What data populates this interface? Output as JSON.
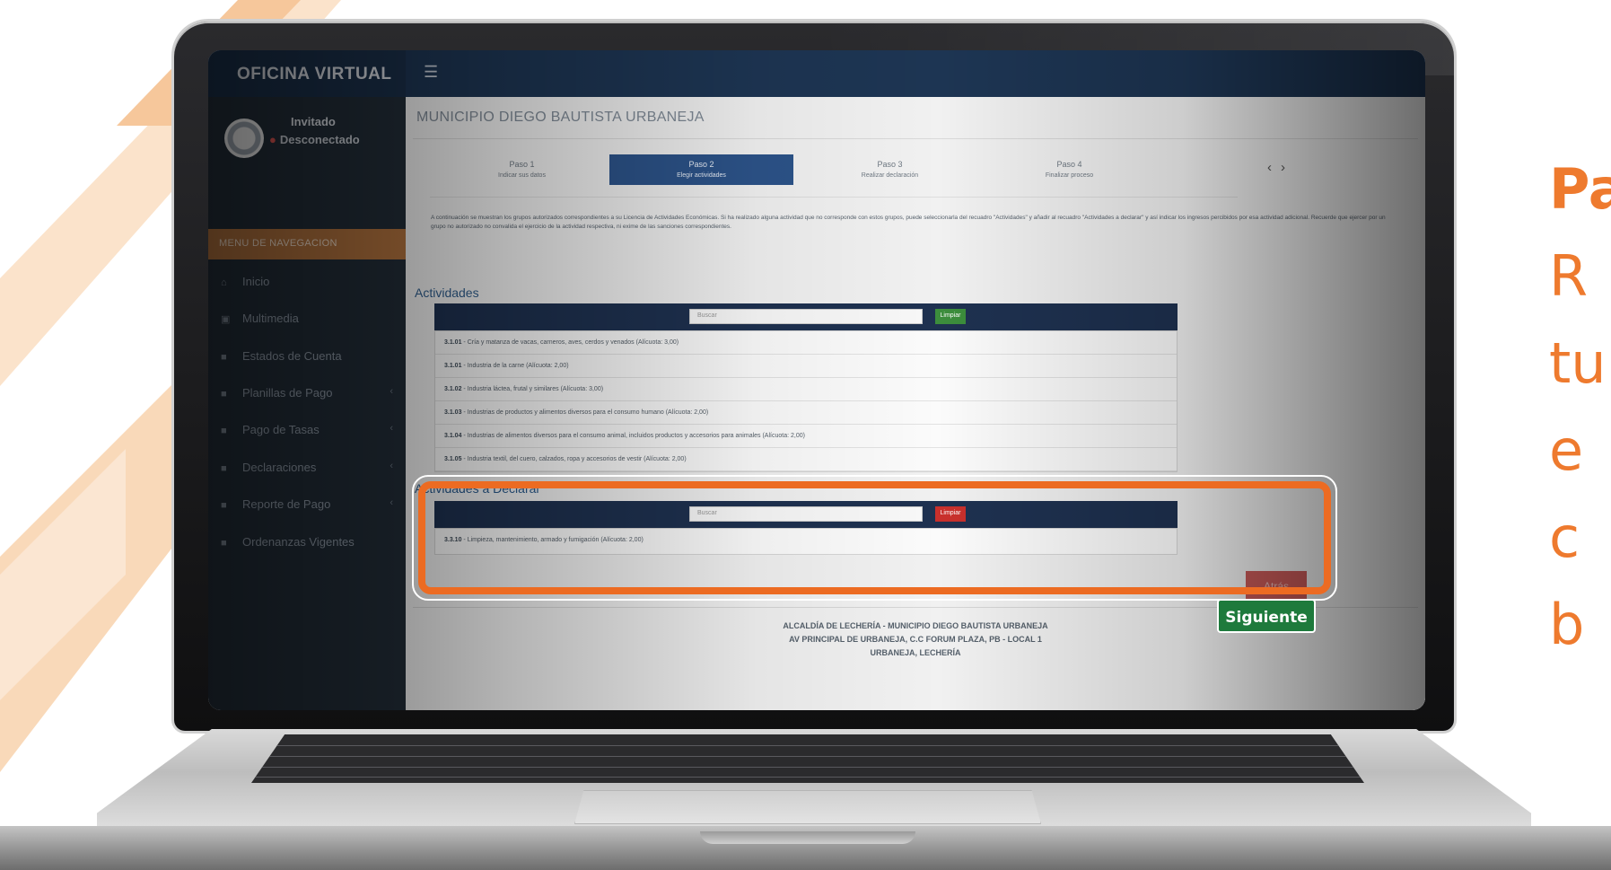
{
  "app": {
    "brand": "OFICINA VIRTUAL",
    "menu_icon": "hamburger-icon",
    "user": {
      "name": "Invitado",
      "status": "Desconectado"
    },
    "nav_header": "MENU DE NAVEGACION",
    "nav_items": [
      {
        "label": "Inicio",
        "icon": "home-icon",
        "caret": false
      },
      {
        "label": "Multimedia",
        "icon": "media-icon",
        "caret": false
      },
      {
        "label": "Estados de Cuenta",
        "icon": "square-icon",
        "caret": false
      },
      {
        "label": "Planillas de Pago",
        "icon": "square-icon",
        "caret": true
      },
      {
        "label": "Pago de Tasas",
        "icon": "square-icon",
        "caret": true
      },
      {
        "label": "Declaraciones",
        "icon": "square-icon",
        "caret": true
      },
      {
        "label": "Reporte de Pago",
        "icon": "square-icon",
        "caret": true
      },
      {
        "label": "Ordenanzas Vigentes",
        "icon": "square-icon",
        "caret": false
      }
    ]
  },
  "page": {
    "title": "MUNICIPIO DIEGO BAUTISTA URBANEJA",
    "steps": [
      {
        "title": "Paso 1",
        "subtitle": "Indicar sus datos"
      },
      {
        "title": "Paso 2",
        "subtitle": "Elegir actividades"
      },
      {
        "title": "Paso 3",
        "subtitle": "Realizar declaración"
      },
      {
        "title": "Paso 4",
        "subtitle": "Finalizar proceso"
      }
    ],
    "active_step": 1,
    "instructions": "A continuación se muestran los grupos autorizados correspondientes a su Licencia de Actividades Económicas. Si ha realizado alguna actividad que no corresponde con estos grupos, puede seleccionarla del recuadro \"Actividades\" y añadir al recuadro \"Actividades a declarar\" y así indicar los ingresos percibidos por esa actividad adicional. Recuerde que ejercer por un grupo no autorizado no convalida el ejercicio de la actividad respectiva, ni exime de las sanciones correspondientes.",
    "activities": {
      "title": "Actividades",
      "search_placeholder": "Buscar",
      "search_button": "Limpiar",
      "rows": [
        {
          "code": "3.1.01",
          "text": "Cría y matanza de vacas, carneros, aves, cerdos y venados (Alícuota: 3,00)"
        },
        {
          "code": "3.1.01",
          "text": "Industria de la carne (Alícuota: 2,00)"
        },
        {
          "code": "3.1.02",
          "text": "Industria láctea, frutal y similares (Alícuota: 3,00)"
        },
        {
          "code": "3.1.03",
          "text": "Industrias de productos y alimentos diversos para el consumo humano (Alícuota: 2,00)"
        },
        {
          "code": "3.1.04",
          "text": "Industrias de alimentos diversos para el consumo animal, incluidos productos y accesorios para animales (Alícuota: 2,00)"
        },
        {
          "code": "3.1.05",
          "text": "Industria textil, del cuero, calzados, ropa y accesorios de vestir (Alícuota: 2,00)"
        }
      ]
    },
    "declare": {
      "title": "Actividades a Declarar",
      "search_placeholder": "Buscar",
      "search_button": "Limpiar",
      "rows": [
        {
          "code": "3.3.10",
          "text": "Limpieza, mantenimiento, armado y fumigación (Alícuota: 2,00)"
        }
      ]
    },
    "buttons": {
      "back": "Atrás",
      "next": "Siguiente"
    },
    "footer": [
      "ALCALDÍA DE LECHERÍA - MUNICIPIO DIEGO BAUTISTA URBANEJA",
      "AV PRINCIPAL DE URBANEJA, C.C FORUM PLAZA, PB - LOCAL 1",
      "URBANEJA, LECHERÍA"
    ]
  },
  "side_text": [
    "Pa",
    "R",
    "tu",
    "e",
    "c",
    "b"
  ],
  "colors": {
    "accent_orange": "#ec6b22",
    "next_green": "#1e7a3c",
    "header_navy": "#1e3150",
    "active_step_blue": "#2c5389"
  }
}
